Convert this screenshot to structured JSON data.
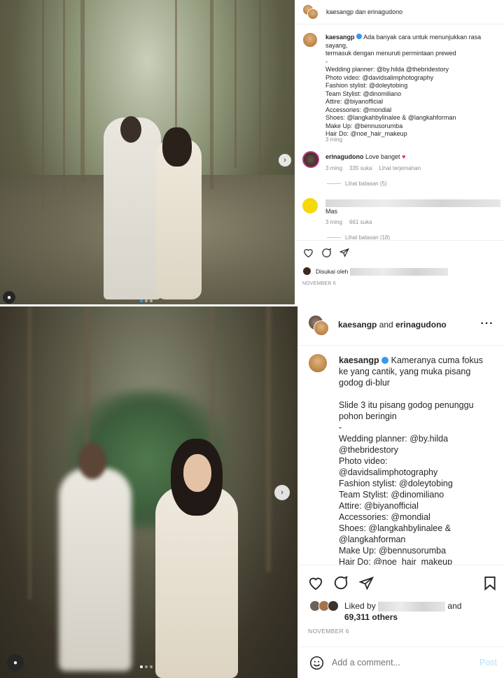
{
  "post1": {
    "header": {
      "usernames": "kaesangp dan erinagudono"
    },
    "caption": {
      "username": "kaesangp",
      "lines": [
        "Ada banyak cara untuk menunjukkan rasa sayang,",
        "termasuk dengan menuruti permintaan prewed",
        "-",
        "Wedding planner: @by.hilda @thebridestory",
        "Photo video: @davidsalimphotography",
        "Fashion stylist: @doleytobing",
        "Team Stylist: @dinomiliano",
        "Attire: @biyanofficial",
        "Accessories: @mondial",
        "Shoes: @langkahbylinalee & @langkahforman",
        "Make Up: @bennusorumba",
        "Hair Do: @noe_hair_makeup"
      ],
      "time": "3 ming"
    },
    "comment1": {
      "username": "erinagudono",
      "text": "Love banget",
      "time": "3 ming",
      "likes": "335 suka",
      "translate": "Lihat terjemahan",
      "replies": "Lihat balasan (5)"
    },
    "comment2": {
      "text": "Mas",
      "time": "3 ming",
      "likes": "661 suka",
      "replies": "Lihat balasan (18)"
    },
    "liked_by_prefix": "Disukai oleh",
    "date": "NOVEMBER 6"
  },
  "post2": {
    "header": {
      "user1": "kaesangp",
      "and": "and",
      "user2": "erinagudono"
    },
    "caption": {
      "username": "kaesangp",
      "lines": [
        "Kameranya cuma fokus",
        "ke yang cantik, yang muka pisang",
        "godog di-blur",
        "",
        "Slide 3 itu pisang godog penunggu",
        "pohon beringin",
        "-",
        "Wedding planner: @by.hilda",
        "@thebridestory",
        "Photo video:",
        "@davidsalimphotography",
        "Fashion stylist: @doleytobing",
        "Team Stylist: @dinomiliano",
        "Attire: @biyanofficial",
        "Accessories: @mondial",
        "Shoes: @langkahbylinalee &",
        "@langkahforman",
        "Make Up: @bennusorumba",
        "Hair Do: @noe_hair_makeup"
      ]
    },
    "liked_by_prefix": "Liked by",
    "liked_by_and": "and",
    "others": "69,311 others",
    "date": "NOVEMBER 6",
    "comment_placeholder": "Add a comment...",
    "post_button": "Post"
  },
  "icons": {
    "like": "heart-icon",
    "comment": "comment-icon",
    "share": "send-icon",
    "save": "bookmark-icon",
    "more": "more-icon",
    "emoji": "emoji-icon",
    "next": "chevron-right-icon",
    "user": "user-tag-icon",
    "verified": "verified-icon"
  },
  "colors": {
    "link": "#00376b",
    "verified": "#3897f0",
    "post_disabled": "#b2dffc"
  }
}
